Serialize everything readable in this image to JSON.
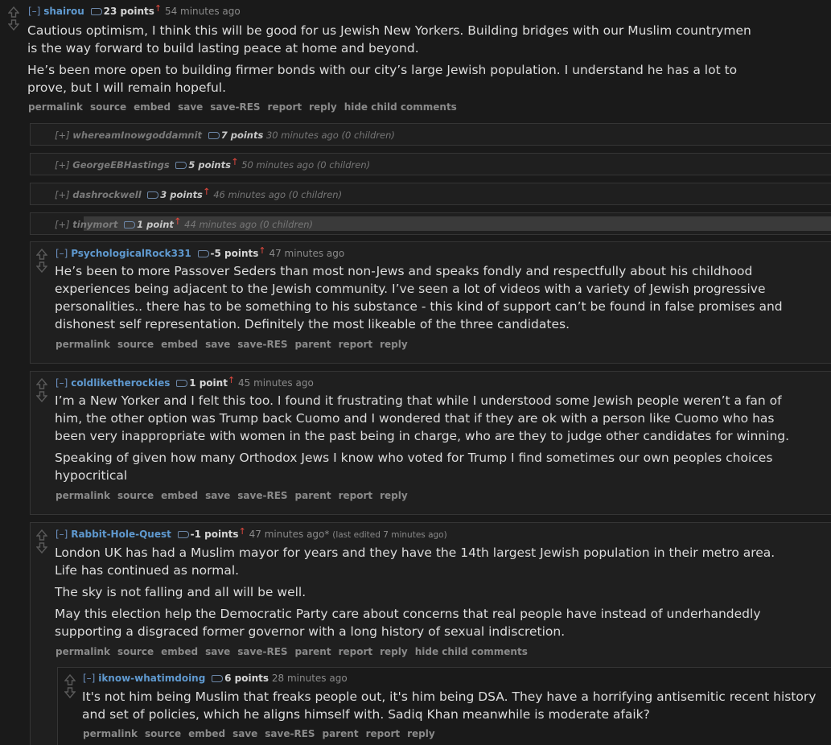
{
  "top_comment": {
    "expand": "[–]",
    "author": "shairou",
    "score": "23 points",
    "up": "↑",
    "time": "54 minutes ago",
    "paragraphs": [
      "Cautious optimism, I think this will be good for us Jewish New Yorkers. Building bridges with our Muslim countrymen is the way forward to build lasting peace at home and beyond.",
      "He’s been more open to building firmer bonds with our city’s large Jewish population. I understand he has a lot to prove, but I will remain hopeful."
    ],
    "actions": [
      "permalink",
      "source",
      "embed",
      "save",
      "save-RES",
      "report",
      "reply",
      "hide child comments"
    ]
  },
  "collapsed": [
    {
      "expand": "[+]",
      "author": "whereamInowgoddamnit",
      "score": "7 points",
      "up": "",
      "rest": "30 minutes ago (0 children)"
    },
    {
      "expand": "[+]",
      "author": "GeorgeEBHastings",
      "score": "5 points",
      "up": "↑",
      "rest": "50 minutes ago (0 children)"
    },
    {
      "expand": "[+]",
      "author": "dashrockwell",
      "score": "3 points",
      "up": "↑",
      "rest": "46 minutes ago (0 children)"
    },
    {
      "expand": "[+]",
      "author": "tinymort",
      "score": "1 point",
      "up": "↑",
      "rest": "44 minutes ago (0 children)"
    }
  ],
  "comments": [
    {
      "expand": "[–]",
      "author": "PsychologicalRock331",
      "score": "-5 points",
      "up": "↑",
      "time": "47 minutes ago",
      "edited": "",
      "paragraphs": [
        "He’s been to more Passover Seders than most non-Jews and speaks fondly and respectfully about his childhood experiences being adjacent to the Jewish community. I’ve seen a lot of videos with a variety of Jewish progressive personalities.. there has to be something to his substance - this kind of support can’t be found in false promises and dishonest self representation. Definitely the most likeable of the three candidates."
      ],
      "actions": [
        "permalink",
        "source",
        "embed",
        "save",
        "save-RES",
        "parent",
        "report",
        "reply"
      ]
    },
    {
      "expand": "[–]",
      "author": "coldliketherockies",
      "score": "1 point",
      "up": "↑",
      "time": "45 minutes ago",
      "edited": "",
      "paragraphs": [
        "I’m a New Yorker and I felt this too. I found it frustrating that while I understood some Jewish people weren’t a fan of him, the other option was Trump back Cuomo and I wondered that if they are ok with a person like Cuomo who has been very inappropriate with women in the past being in charge, who are they to judge other candidates for winning.",
        "Speaking of given how many Orthodox Jews I know who voted for Trump I find sometimes our own peoples choices hypocritical"
      ],
      "actions": [
        "permalink",
        "source",
        "embed",
        "save",
        "save-RES",
        "parent",
        "report",
        "reply"
      ]
    },
    {
      "expand": "[–]",
      "author": "Rabbit-Hole-Quest",
      "score": "-1 points",
      "up": "↑",
      "time": "47 minutes ago*",
      "edited": "(last edited 7 minutes ago)",
      "paragraphs": [
        "London UK has had a Muslim mayor for years and they have the 14th largest Jewish population in their metro area. Life has continued as normal.",
        "The sky is not falling and all will be well.",
        "May this election help the Democratic Party care about concerns that real people have instead of underhandedly supporting a disgraced former governor with a long history of sexual indiscretion."
      ],
      "actions": [
        "permalink",
        "source",
        "embed",
        "save",
        "save-RES",
        "parent",
        "report",
        "reply",
        "hide child comments"
      ]
    },
    {
      "expand": "[–]",
      "author": "iknow-whatimdoing",
      "score": "6 points",
      "up": "",
      "time": "28 minutes ago",
      "edited": "",
      "paragraphs": [
        "It's not him being Muslim that freaks people out, it's him being DSA. They have a horrifying antisemitic recent history and set of policies, which he aligns himself with. Sadiq Khan meanwhile is moderate afaik?"
      ],
      "actions": [
        "permalink",
        "source",
        "embed",
        "save",
        "save-RES",
        "parent",
        "report",
        "reply"
      ]
    }
  ]
}
